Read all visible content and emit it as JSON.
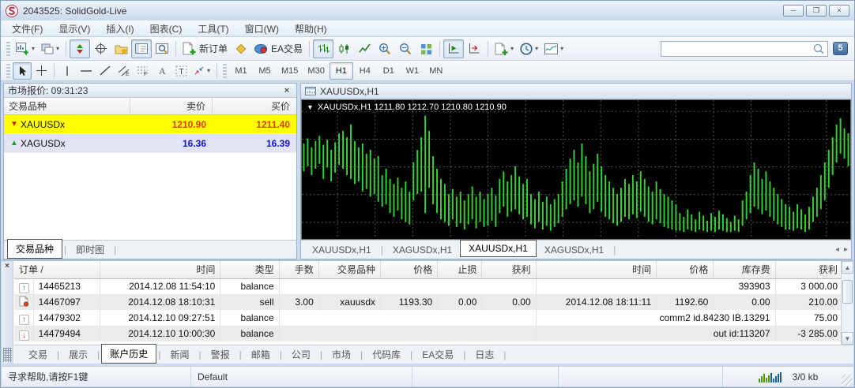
{
  "window": {
    "title": "2043525: SolidGold-Live"
  },
  "icons": {
    "minimize": "─",
    "maximize": "❐",
    "close": "×",
    "dropdown_caret": "▾",
    "ohlc_marker": "▼",
    "arrow_up": "▲",
    "arrow_down": "▼",
    "row_up": "↑",
    "row_down": "↓",
    "scroll_up": "▲",
    "scroll_down": "▼",
    "tab_prev": "◂",
    "tab_next": "▸",
    "tab_divider": "|",
    "sort_ascending": "/"
  },
  "menu": {
    "items": [
      "文件(F)",
      "显示(V)",
      "插入(I)",
      "图表(C)",
      "工具(T)",
      "窗口(W)",
      "帮助(H)"
    ]
  },
  "toolbar": {
    "new_order_label": "新订单",
    "ea_label": "EA交易",
    "search_value": "",
    "notification_count": "5",
    "timeframes": [
      "M1",
      "M5",
      "M15",
      "M30",
      "H1",
      "H4",
      "D1",
      "W1",
      "MN"
    ],
    "active_timeframe": "H1"
  },
  "market_watch": {
    "title": "市场报价: 09:31:23",
    "columns": [
      "交易品种",
      "卖价",
      "买价"
    ],
    "rows": [
      {
        "symbol": "XAUUSDx",
        "bid": "1210.90",
        "ask": "1211.40",
        "direction": "down",
        "highlight": "yellow"
      },
      {
        "symbol": "XAGUSDx",
        "bid": "16.36",
        "ask": "16.39",
        "direction": "up",
        "highlight": "lavender"
      }
    ],
    "tabs": [
      "交易品种",
      "即时图"
    ],
    "active_tab": "交易品种"
  },
  "chart": {
    "window_title": "XAUUSDx,H1",
    "ohlc_label": "XAUUSDx,H1  1211.80 1212.70 1210.80 1210.90",
    "colors": {
      "up": "#35cf35",
      "bg": "#000000",
      "grid": "#5c5c5c"
    },
    "bars": [
      [
        30,
        52
      ],
      [
        26,
        48
      ],
      [
        33,
        55
      ],
      [
        28,
        50
      ],
      [
        24,
        46
      ],
      [
        31,
        58
      ],
      [
        27,
        49
      ],
      [
        35,
        60
      ],
      [
        29,
        53
      ],
      [
        22,
        47
      ],
      [
        20,
        50
      ],
      [
        25,
        55
      ],
      [
        15,
        58
      ],
      [
        28,
        62
      ],
      [
        33,
        60
      ],
      [
        30,
        68
      ],
      [
        38,
        66
      ],
      [
        35,
        72
      ],
      [
        42,
        70
      ],
      [
        40,
        76
      ],
      [
        55,
        80
      ],
      [
        50,
        78
      ],
      [
        58,
        85
      ],
      [
        62,
        88
      ],
      [
        57,
        83
      ],
      [
        65,
        90
      ],
      [
        60,
        92
      ],
      [
        68,
        94
      ],
      [
        45,
        75
      ],
      [
        35,
        70
      ],
      [
        25,
        68
      ],
      [
        8,
        85
      ],
      [
        20,
        65
      ],
      [
        40,
        78
      ],
      [
        50,
        85
      ],
      [
        58,
        90
      ],
      [
        62,
        92
      ],
      [
        70,
        95
      ],
      [
        66,
        90
      ],
      [
        72,
        96
      ],
      [
        68,
        93
      ],
      [
        75,
        98
      ],
      [
        70,
        94
      ],
      [
        64,
        90
      ],
      [
        72,
        97
      ],
      [
        68,
        92
      ],
      [
        74,
        96
      ],
      [
        70,
        95
      ],
      [
        65,
        91
      ],
      [
        71,
        96
      ],
      [
        58,
        85
      ],
      [
        52,
        80
      ],
      [
        60,
        88
      ],
      [
        55,
        84
      ],
      [
        48,
        82
      ],
      [
        56,
        86
      ],
      [
        62,
        90
      ],
      [
        58,
        88
      ],
      [
        70,
        94
      ],
      [
        74,
        97
      ],
      [
        68,
        92
      ],
      [
        76,
        98
      ],
      [
        72,
        95
      ],
      [
        78,
        99
      ],
      [
        74,
        96
      ],
      [
        70,
        93
      ],
      [
        60,
        88
      ],
      [
        50,
        82
      ],
      [
        42,
        78
      ],
      [
        35,
        75
      ],
      [
        45,
        80
      ],
      [
        30,
        72
      ],
      [
        40,
        78
      ],
      [
        52,
        85
      ],
      [
        46,
        82
      ],
      [
        38,
        76
      ],
      [
        48,
        84
      ],
      [
        55,
        88
      ],
      [
        60,
        90
      ],
      [
        65,
        93
      ],
      [
        70,
        95
      ],
      [
        65,
        92
      ],
      [
        58,
        88
      ],
      [
        62,
        90
      ],
      [
        55,
        86
      ],
      [
        60,
        89
      ],
      [
        52,
        84
      ],
      [
        58,
        88
      ],
      [
        64,
        92
      ],
      [
        68,
        94
      ],
      [
        60,
        90
      ],
      [
        66,
        93
      ],
      [
        70,
        96
      ],
      [
        72,
        97
      ],
      [
        75,
        98
      ],
      [
        78,
        99
      ],
      [
        85,
        99
      ],
      [
        88,
        100
      ],
      [
        82,
        98
      ],
      [
        86,
        99
      ],
      [
        90,
        100
      ],
      [
        84,
        98
      ],
      [
        87,
        99
      ],
      [
        91,
        100
      ],
      [
        85,
        99
      ],
      [
        88,
        100
      ],
      [
        83,
        98
      ],
      [
        86,
        99
      ],
      [
        89,
        100
      ],
      [
        92,
        100
      ],
      [
        87,
        99
      ],
      [
        90,
        100
      ],
      [
        75,
        95
      ],
      [
        68,
        90
      ],
      [
        55,
        85
      ],
      [
        45,
        80
      ],
      [
        50,
        82
      ],
      [
        58,
        86
      ],
      [
        52,
        83
      ],
      [
        60,
        88
      ],
      [
        65,
        91
      ],
      [
        70,
        94
      ],
      [
        74,
        96
      ],
      [
        78,
        98
      ],
      [
        80,
        98
      ],
      [
        84,
        99
      ],
      [
        78,
        97
      ],
      [
        82,
        98
      ],
      [
        86,
        100
      ],
      [
        80,
        98
      ],
      [
        72,
        92
      ],
      [
        65,
        88
      ],
      [
        55,
        82
      ],
      [
        45,
        75
      ],
      [
        35,
        65
      ],
      [
        25,
        55
      ],
      [
        15,
        45
      ],
      [
        10,
        38
      ],
      [
        18,
        42
      ],
      [
        22,
        48
      ]
    ]
  },
  "chart_tabs": {
    "items": [
      "XAUUSDx,H1",
      "XAGUSDx,H1",
      "XAUUSDx,H1",
      "XAGUSDx,H1"
    ],
    "active_index": 2
  },
  "terminal": {
    "columns": [
      "订单",
      "时间",
      "类型",
      "手数",
      "交易品种",
      "价格",
      "止损",
      "获利",
      "时间",
      "价格",
      "库存费",
      "获利"
    ],
    "rows": [
      {
        "icon": "up",
        "order": "14465213",
        "time": "2014.12.08 11:54:10",
        "type": "balance",
        "comment": "393903",
        "profit": "3 000.00"
      },
      {
        "icon": "doc",
        "order": "14467097",
        "time": "2014.12.08 18:10:31",
        "type": "sell",
        "lots": "3.00",
        "symbol": "xauusdx",
        "price": "1193.30",
        "sl": "0.00",
        "tp": "0.00",
        "close_time": "2014.12.08 18:11:11",
        "close_price": "1192.60",
        "swap": "0.00",
        "profit": "210.00"
      },
      {
        "icon": "up",
        "order": "14479302",
        "time": "2014.12.10 09:27:51",
        "type": "balance",
        "comment": "comm2 id.84230 IB.13291",
        "profit": "75.00"
      },
      {
        "icon": "down",
        "order": "14479494",
        "time": "2014.12.10 10:00:30",
        "type": "balance",
        "comment": "out id:113207",
        "profit": "-3 285.00"
      }
    ],
    "tabs": [
      "交易",
      "展示",
      "账户历史",
      "新闻",
      "警报",
      "邮箱",
      "公司",
      "市场",
      "代码库",
      "EA交易",
      "日志"
    ],
    "active_tab": "账户历史"
  },
  "status_bar": {
    "help": "寻求帮助,请按F1键",
    "profile": "Default",
    "traffic": "3/0 kb"
  }
}
